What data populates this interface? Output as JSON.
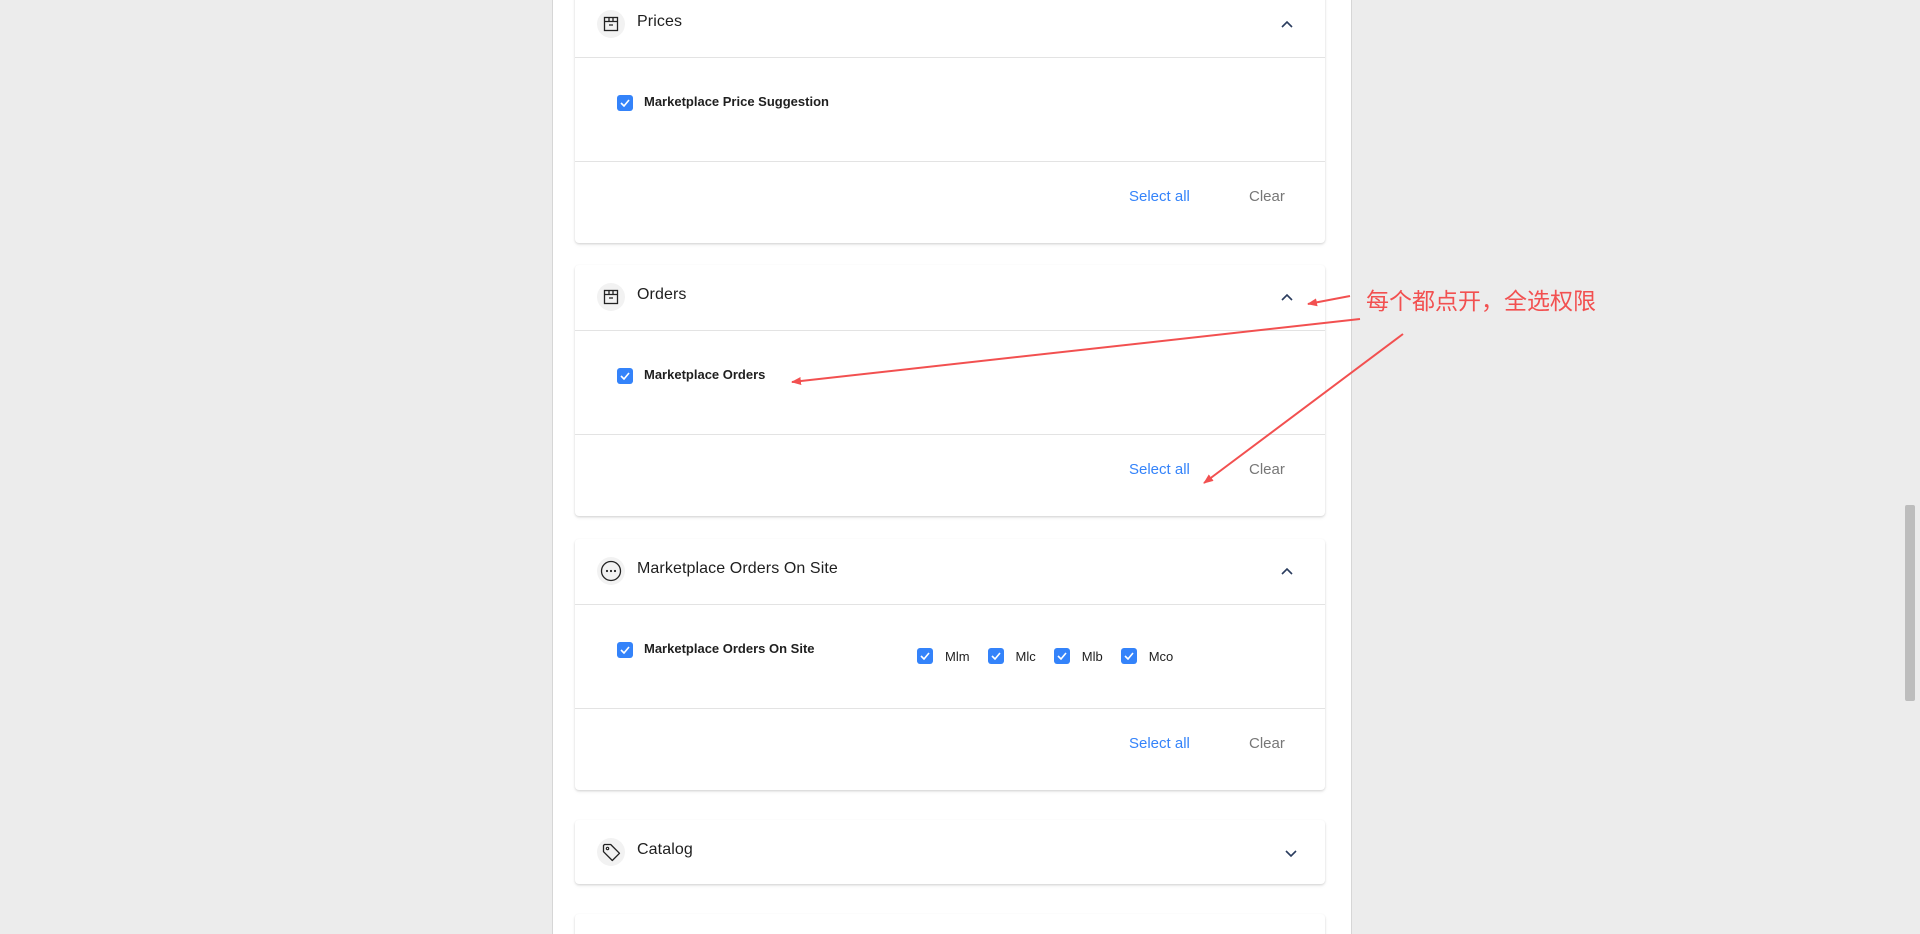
{
  "colors": {
    "accent": "#3483fa",
    "annotation": "#f25050",
    "muted": "#777777"
  },
  "sections": [
    {
      "title": "Prices",
      "icon": "box-icon",
      "expanded": true,
      "permission": "Marketplace Price Suggestion",
      "select_all": "Select all",
      "clear": "Clear"
    },
    {
      "title": "Orders",
      "icon": "box-icon",
      "expanded": true,
      "permission": "Marketplace Orders",
      "select_all": "Select all",
      "clear": "Clear"
    },
    {
      "title": "Marketplace Orders On Site",
      "icon": "more-horizontal-icon",
      "expanded": true,
      "permission": "Marketplace Orders On Site",
      "sites": [
        "Mlm",
        "Mlc",
        "Mlb",
        "Mco"
      ],
      "select_all": "Select all",
      "clear": "Clear"
    },
    {
      "title": "Catalog",
      "icon": "tag-icon",
      "expanded": false
    }
  ],
  "annotation": {
    "text": "每个都点开，全选权限"
  }
}
